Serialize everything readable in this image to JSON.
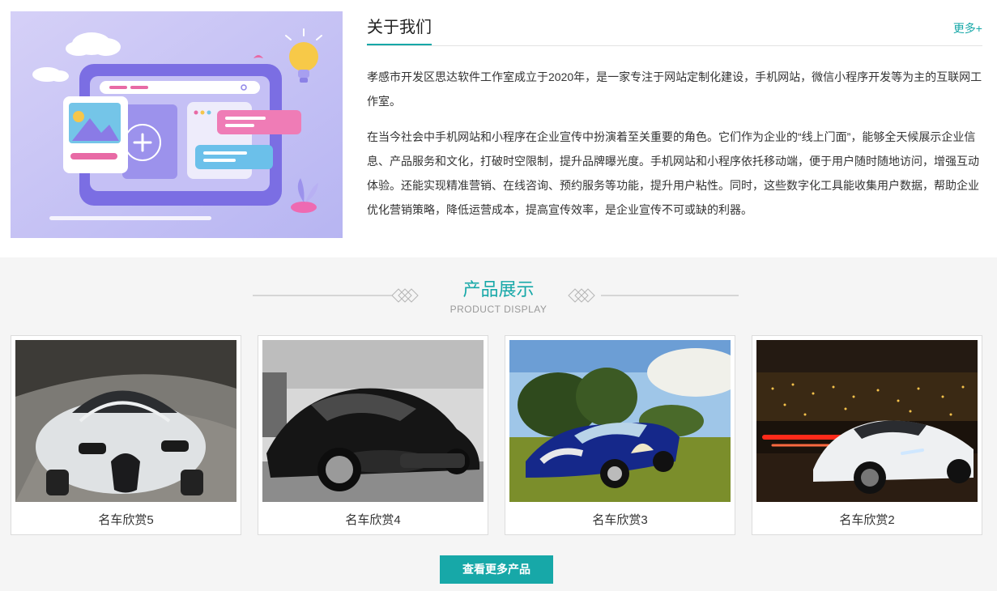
{
  "about": {
    "title": "关于我们",
    "more": "更多+",
    "paragraphs": [
      "孝感市开发区思达软件工作室成立于2020年，是一家专注于网站定制化建设，手机网站，微信小程序开发等为主的互联网工作室。",
      "在当今社会中手机网站和小程序在企业宣传中扮演着至关重要的角色。它们作为企业的“线上门面”，能够全天候展示企业信息、产品服务和文化，打破时空限制，提升品牌曝光度。手机网站和小程序依托移动端，便于用户随时随地访问，增强互动体验。还能实现精准营销、在线咨询、预约服务等功能，提升用户粘性。同时，这些数字化工具能收集用户数据，帮助企业优化营销策略，降低运营成本，提高宣传效率，是企业宣传不可或缺的利器。"
    ]
  },
  "products": {
    "title": "产品展示",
    "subtitle": "PRODUCT DISPLAY",
    "items": [
      {
        "name": "名车欣赏5"
      },
      {
        "name": "名车欣赏4"
      },
      {
        "name": "名车欣赏3"
      },
      {
        "name": "名车欣赏2"
      }
    ],
    "more_button": "查看更多产品"
  },
  "colors": {
    "accent": "#17a8a8"
  }
}
